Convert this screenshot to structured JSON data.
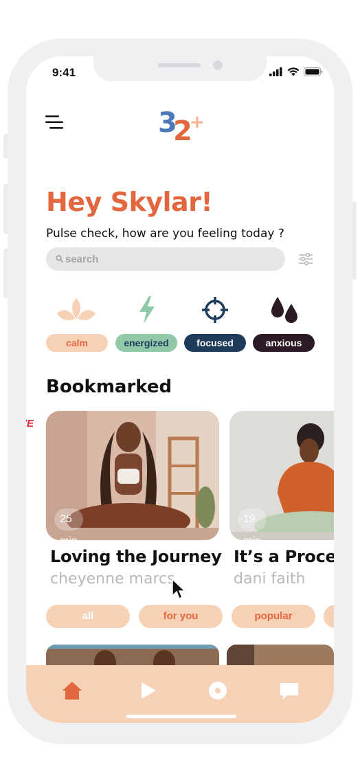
{
  "status_bar": {
    "time": "9:41"
  },
  "header": {
    "logo_main": "32",
    "logo_plus": "+"
  },
  "greeting": "Hey Skylar!",
  "subtitle": "Pulse check, how are you feeling today ?",
  "search": {
    "placeholder": "search"
  },
  "moods": [
    {
      "label": "calm",
      "icon": "lotus-icon",
      "pill_bg": "#f7d1b6",
      "pill_fg": "#e2673e",
      "icon_color": "#f7d1b6"
    },
    {
      "label": "energized",
      "icon": "lightning-icon",
      "pill_bg": "#8fc9a7",
      "pill_fg": "#1f3b5c",
      "icon_color": "#8fc9a7"
    },
    {
      "label": "focused",
      "icon": "crosshair-icon",
      "pill_bg": "#1f3b5c",
      "pill_fg": "#ffffff",
      "icon_color": "#1f3b5c"
    },
    {
      "label": "anxious",
      "icon": "droplets-icon",
      "pill_bg": "#2a1b25",
      "pill_fg": "#ffffff",
      "icon_color": "#2a1b25"
    }
  ],
  "bookmarked": {
    "title": "Bookmarked",
    "items": [
      {
        "title": "Loving the Journey",
        "author": "cheyenne marcs",
        "duration": "25 min",
        "live": "LIVE"
      },
      {
        "title": "It’s a Process",
        "author": "dani faith",
        "duration": "19 min"
      }
    ]
  },
  "filter_tabs": [
    "all",
    "for you",
    "popular"
  ],
  "bottom_nav": [
    {
      "name": "home-icon",
      "active": true
    },
    {
      "name": "play-icon",
      "active": false
    },
    {
      "name": "record-icon",
      "active": false
    },
    {
      "name": "chat-icon",
      "active": false
    }
  ],
  "colors": {
    "accent": "#e2673e",
    "peach": "#f7d1b6",
    "navy": "#1f3b5c",
    "live": "#e3262b"
  }
}
